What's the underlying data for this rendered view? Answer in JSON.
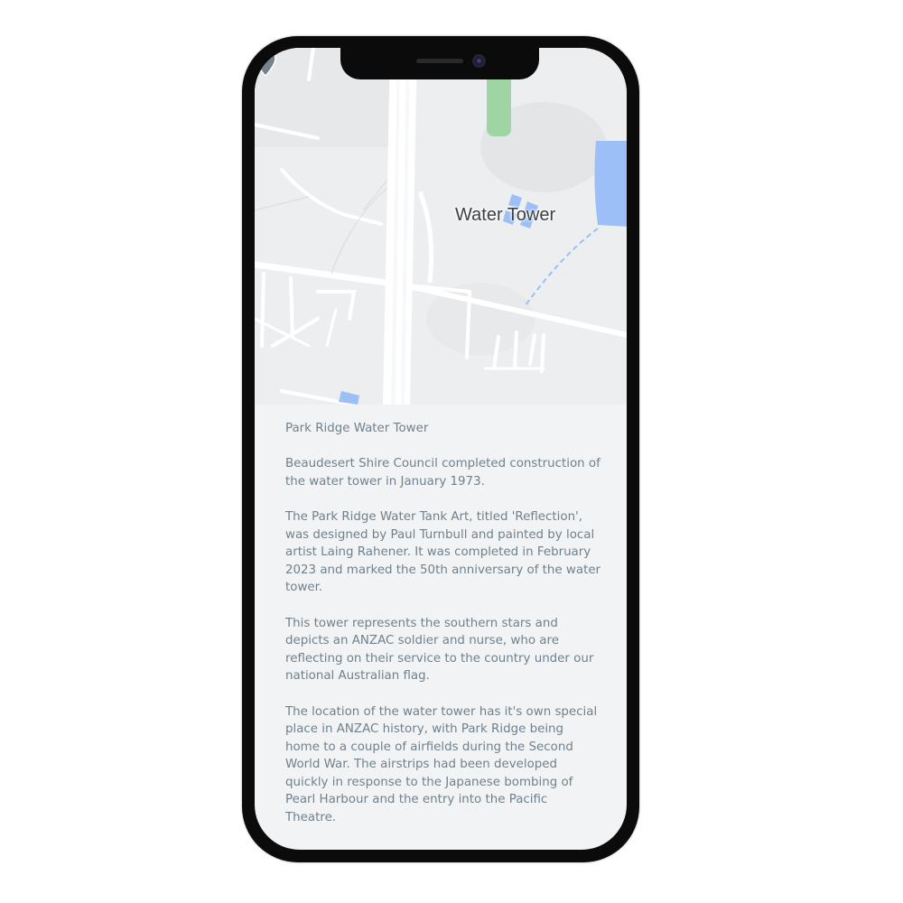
{
  "map": {
    "marker_label": "Water Tower",
    "marker_icon": "map-pin-icon",
    "colors": {
      "background": "#eceef0",
      "road": "#ffffff",
      "water": "#9cbff7",
      "park": "#9fd4a3",
      "pin": "#73828c"
    }
  },
  "info": {
    "title": "Park Ridge Water Tower",
    "paragraphs": [
      "Beaudesert Shire Council completed construction of the water tower in January 1973.",
      "The Park Ridge Water Tank Art, titled 'Reflection', was designed by Paul Turnbull and painted by local artist Laing Rahener. It was completed in February 2023 and marked the 50th anniversary of the water tower.",
      "This tower represents the southern stars and depicts an ANZAC soldier and nurse, who are reflecting on their service to the country under our national Australian flag.",
      "The location of the water tower has it's own special place in ANZAC history, with Park Ridge being home to a couple of airfields during the Second World War. The airstrips had been developed quickly in response to the Japanese bombing of Pearl Harbour and the entry into the Pacific Theatre."
    ],
    "text_color": "#70818d"
  }
}
